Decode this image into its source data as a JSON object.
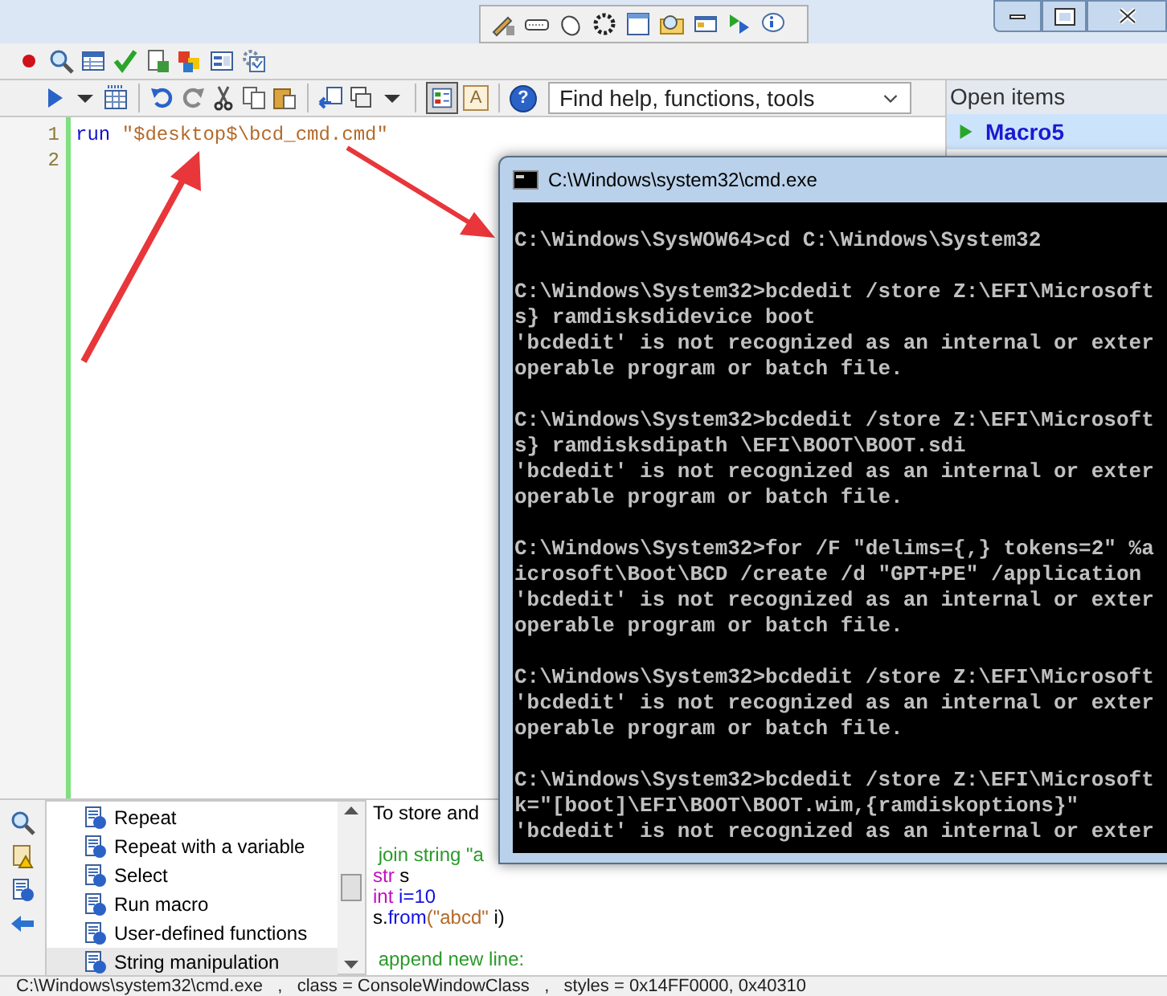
{
  "toolbar": {
    "font_button": "A",
    "help_glyph": "?",
    "search": {
      "placeholder": "Find help, functions, tools"
    }
  },
  "open_items": {
    "title": "Open items",
    "items": [
      {
        "label": "Macro5",
        "selected": true
      }
    ]
  },
  "editor": {
    "lines": [
      {
        "number": "1",
        "tokens": [
          {
            "text": "run ",
            "kind": "keyword"
          },
          {
            "text": "\"$desktop$\\bcd_cmd.cmd\"",
            "kind": "string"
          }
        ]
      },
      {
        "number": "2"
      }
    ]
  },
  "reference_list": {
    "items": [
      {
        "label": "Repeat",
        "selected": false
      },
      {
        "label": "Repeat with a variable",
        "selected": false
      },
      {
        "label": "Select",
        "selected": false
      },
      {
        "label": "Run macro",
        "selected": false
      },
      {
        "label": "User-defined functions",
        "selected": false
      },
      {
        "label": "String manipulation",
        "selected": true
      }
    ]
  },
  "help_text": {
    "paragraphs": [
      [
        {
          "tokens": [
            {
              "text": "To store and",
              "kind": "plain"
            }
          ]
        }
      ],
      [
        {
          "tokens": [
            {
              "text": " join string \"a",
              "kind": "comment"
            }
          ]
        },
        {
          "tokens": [
            {
              "text": "str",
              "kind": "type"
            },
            {
              "text": " s",
              "kind": "plain"
            }
          ]
        },
        {
          "tokens": [
            {
              "text": "int",
              "kind": "type"
            },
            {
              "text": " i=10",
              "kind": "func"
            }
          ]
        },
        {
          "tokens": [
            {
              "text": "s.",
              "kind": "plain"
            },
            {
              "text": "from",
              "kind": "func"
            },
            {
              "text": "(\"abcd\"",
              "kind": "string"
            },
            {
              "text": " i)",
              "kind": "plain"
            }
          ]
        }
      ],
      [
        {
          "tokens": [
            {
              "text": " append new line:",
              "kind": "comment"
            }
          ]
        }
      ]
    ]
  },
  "console_window": {
    "title": "C:\\Windows\\system32\\cmd.exe",
    "blocks": [
      [
        "C:\\Windows\\SysWOW64>cd C:\\Windows\\System32"
      ],
      [
        "C:\\Windows\\System32>bcdedit /store Z:\\EFI\\Microsoft",
        "s} ramdisksdidevice boot",
        "'bcdedit' is not recognized as an internal or exter",
        "operable program or batch file."
      ],
      [
        "C:\\Windows\\System32>bcdedit /store Z:\\EFI\\Microsoft",
        "s} ramdisksdipath \\EFI\\BOOT\\BOOT.sdi",
        "'bcdedit' is not recognized as an internal or exter",
        "operable program or batch file."
      ],
      [
        "C:\\Windows\\System32>for /F \"delims={,} tokens=2\" %a",
        "icrosoft\\Boot\\BCD /create /d \"GPT+PE\" /application",
        "'bcdedit' is not recognized as an internal or exter",
        "operable program or batch file."
      ],
      [
        "C:\\Windows\\System32>bcdedit /store Z:\\EFI\\Microsoft",
        "'bcdedit' is not recognized as an internal or exter",
        "operable program or batch file."
      ],
      [
        "C:\\Windows\\System32>bcdedit /store Z:\\EFI\\Microsoft",
        "k=\"[boot]\\EFI\\BOOT\\BOOT.wim,{ramdiskoptions}\"",
        "'bcdedit' is not recognized as an internal or exter"
      ]
    ]
  },
  "status_bar": "C:\\Windows\\system32\\cmd.exe   ,   class = ConsoleWindowClass   ,   styles = 0x14FF0000, 0x40310"
}
